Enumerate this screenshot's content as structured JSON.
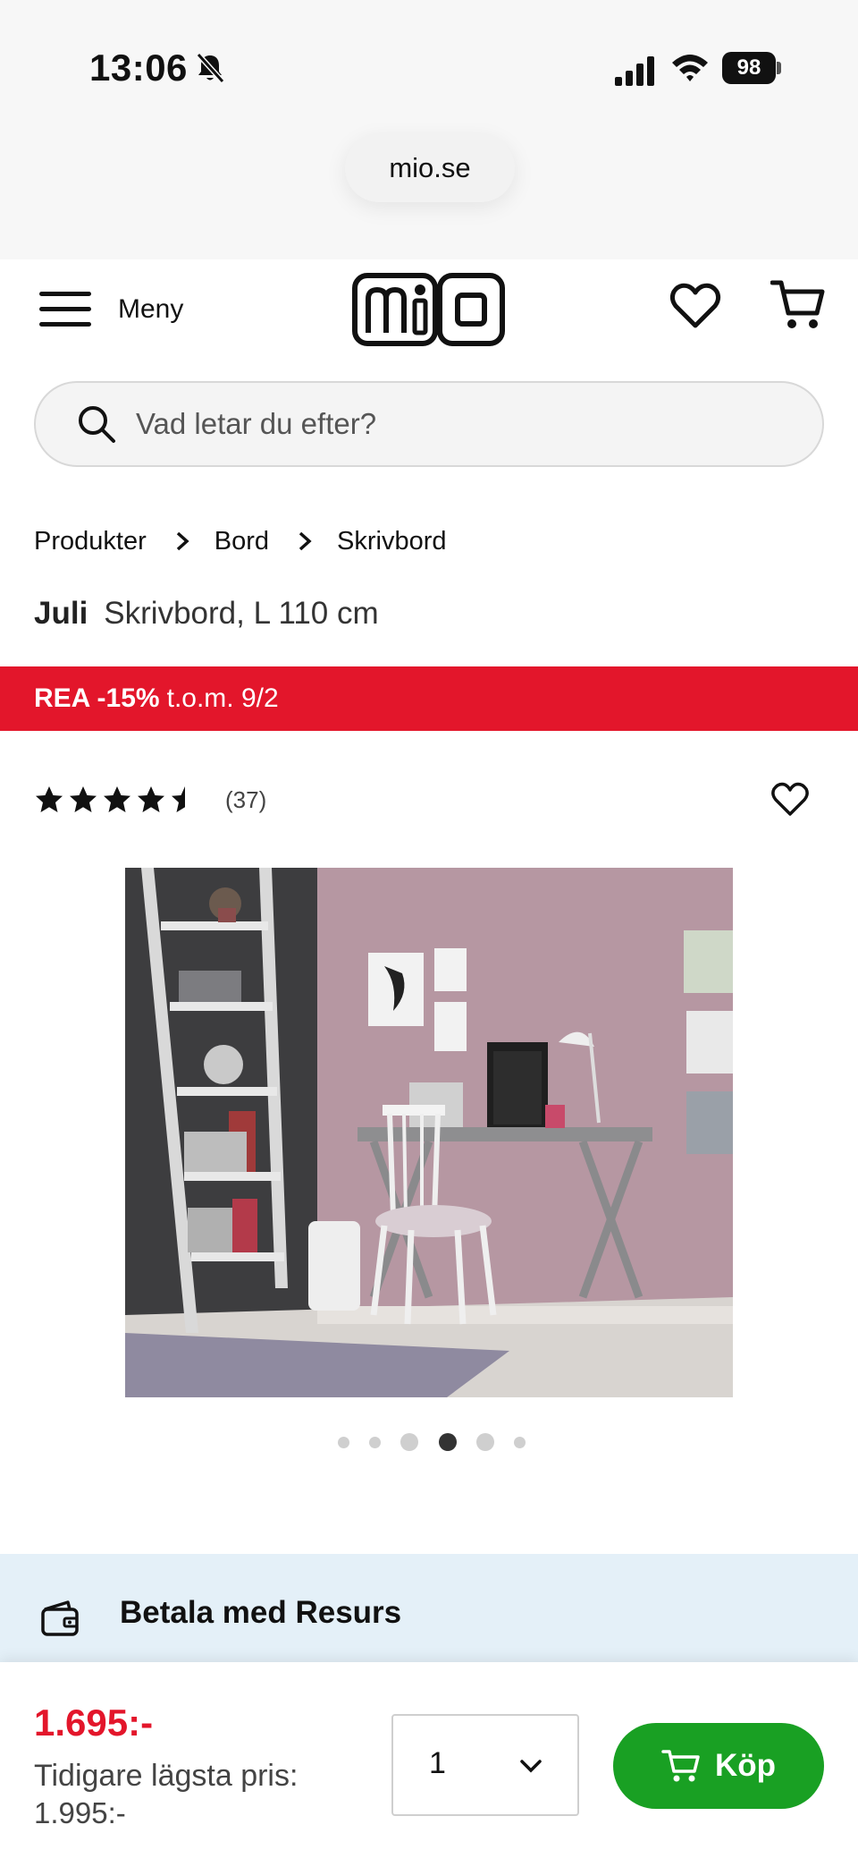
{
  "status_bar": {
    "time": "13:06",
    "battery": "98"
  },
  "browser": {
    "url": "mio.se"
  },
  "header": {
    "menu_label": "Meny",
    "logo_text": "mio"
  },
  "search": {
    "placeholder": "Vad letar du efter?"
  },
  "breadcrumb": {
    "items": [
      "Produkter",
      "Bord",
      "Skrivbord"
    ]
  },
  "product": {
    "brand": "Juli",
    "title": "Skrivbord, L 110 cm",
    "rating": 4.5,
    "review_count": "(37)",
    "image_count": 6,
    "active_image": 4
  },
  "sale": {
    "label": "REA -15%",
    "terms": "t.o.m. 9/2",
    "color": "#e3162b"
  },
  "payment": {
    "title": "Betala med Resurs"
  },
  "purchase": {
    "price": "1.695:-",
    "prev_price_label": "Tidigare lägsta pris:",
    "prev_price_value": "1.995:-",
    "quantity": "1",
    "buy_label": "Köp",
    "buy_color": "#19a023"
  },
  "icons": [
    "bell-muted-icon",
    "signal-icon",
    "wifi-icon",
    "battery-icon",
    "menu-icon",
    "heart-icon",
    "cart-icon",
    "search-icon",
    "chevron-right-icon",
    "star-icon",
    "wallet-icon",
    "chevron-down-icon"
  ]
}
